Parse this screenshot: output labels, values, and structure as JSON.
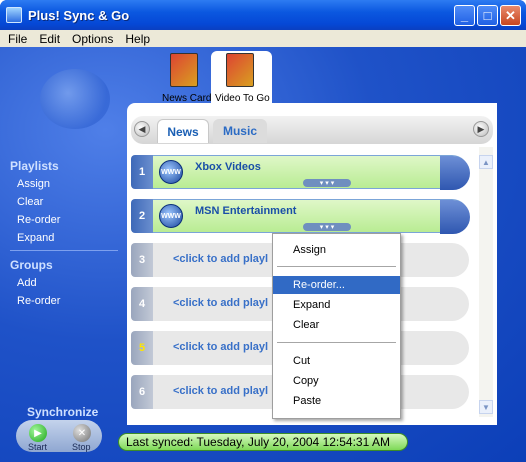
{
  "window": {
    "title": "Plus! Sync & Go"
  },
  "menubar": {
    "items": [
      "File",
      "Edit",
      "Options",
      "Help"
    ]
  },
  "cards": [
    {
      "label": "News Card",
      "selected": false
    },
    {
      "label": "Video To Go",
      "selected": true
    }
  ],
  "subtabs": [
    {
      "label": "News",
      "selected": true
    },
    {
      "label": "Music",
      "selected": false
    }
  ],
  "sidebar": {
    "playlists_title": "Playlists",
    "playlist_links": [
      "Assign",
      "Clear",
      "Re-order",
      "Expand"
    ],
    "groups_title": "Groups",
    "group_links": [
      "Add",
      "Re-order"
    ]
  },
  "playlists": [
    {
      "num": "1",
      "title": "Xbox Videos",
      "icon_text": "WWW"
    },
    {
      "num": "2",
      "title": "MSN Entertainment",
      "icon_text": "WWW"
    },
    {
      "num": "3",
      "title": "<click to add playl"
    },
    {
      "num": "4",
      "title": "<click to add playl"
    },
    {
      "num": "5",
      "title": "<click to add playl"
    },
    {
      "num": "6",
      "title": "<click to add playl"
    }
  ],
  "sync": {
    "title": "Synchronize",
    "start_label": "Start",
    "stop_label": "Stop"
  },
  "status": {
    "text": "Last synced: Tuesday, July 20, 2004 12:54:31 AM"
  },
  "context_menu": {
    "items": [
      "Assign",
      "Re-order...",
      "Expand",
      "Clear",
      "Cut",
      "Copy",
      "Paste"
    ],
    "highlighted": "Re-order..."
  },
  "colors": {
    "accent": "#0a47d8",
    "highlight": "#316ac5",
    "status_green": "#7ed957"
  }
}
